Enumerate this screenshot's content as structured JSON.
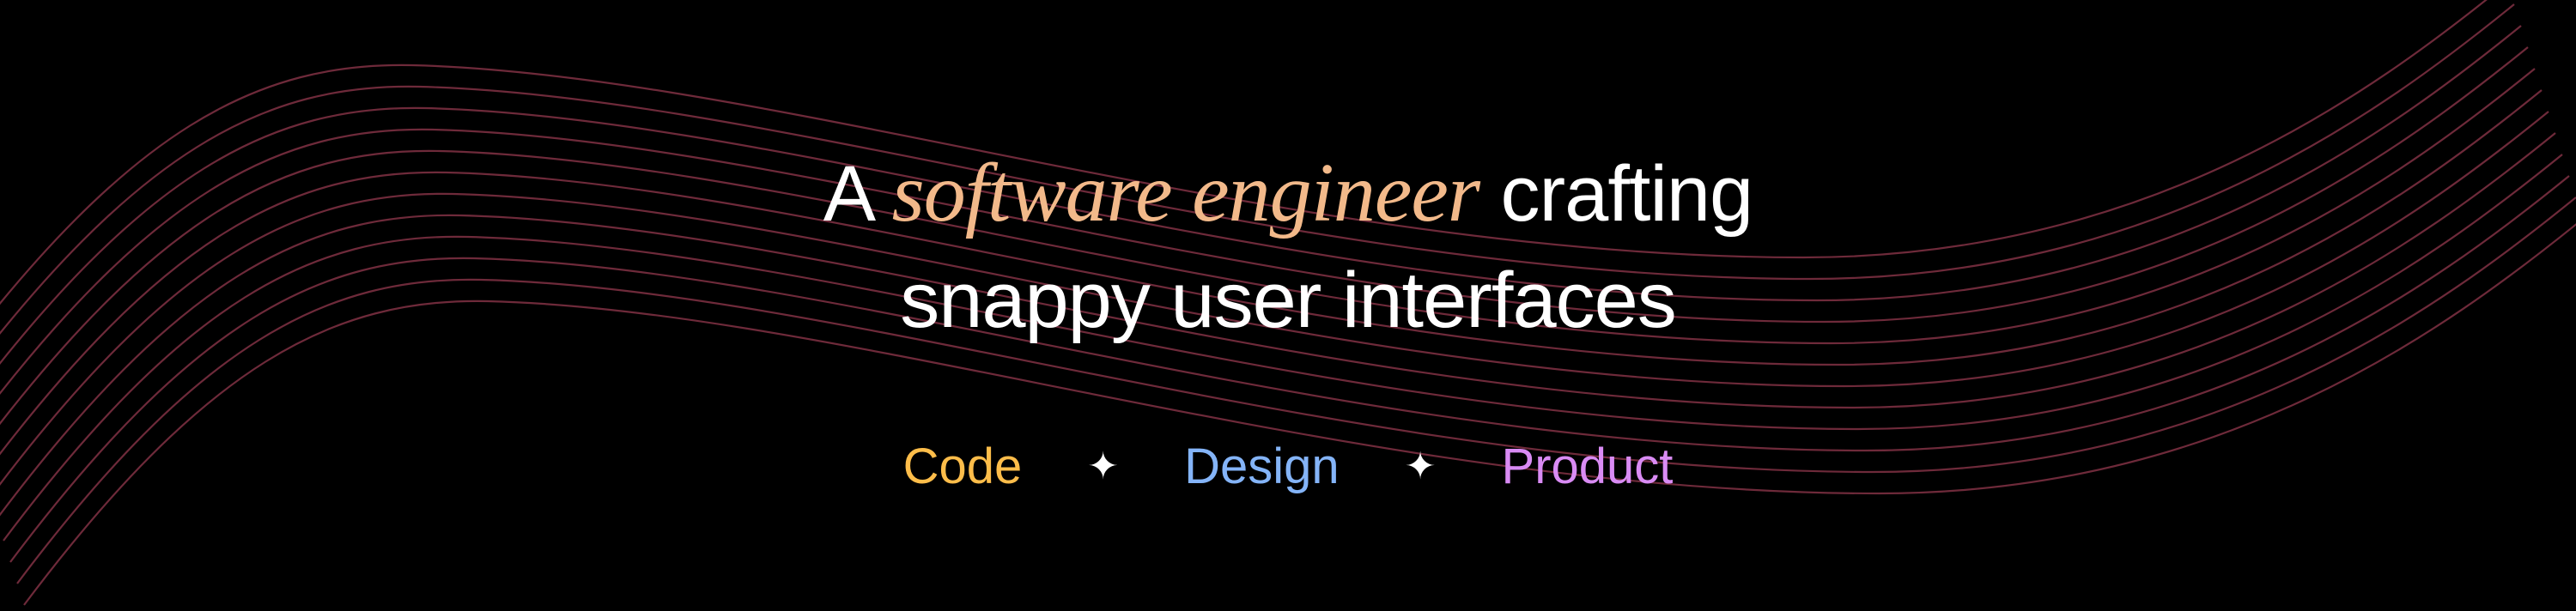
{
  "headline": {
    "prefix": "A",
    "emphasis": "software engineer",
    "suffix": "crafting",
    "line2": "snappy user interfaces"
  },
  "tags": [
    {
      "label": "Code",
      "color": "#fdbd4a"
    },
    {
      "label": "Design",
      "color": "#84b4f8"
    },
    {
      "label": "Product",
      "color": "#d98bf4"
    }
  ],
  "separator_icon": "four-point-star-icon",
  "colors": {
    "background": "#000000",
    "wave_lines": "#6e2a3a",
    "emphasis": "#f2b98a",
    "text": "#ffffff"
  }
}
